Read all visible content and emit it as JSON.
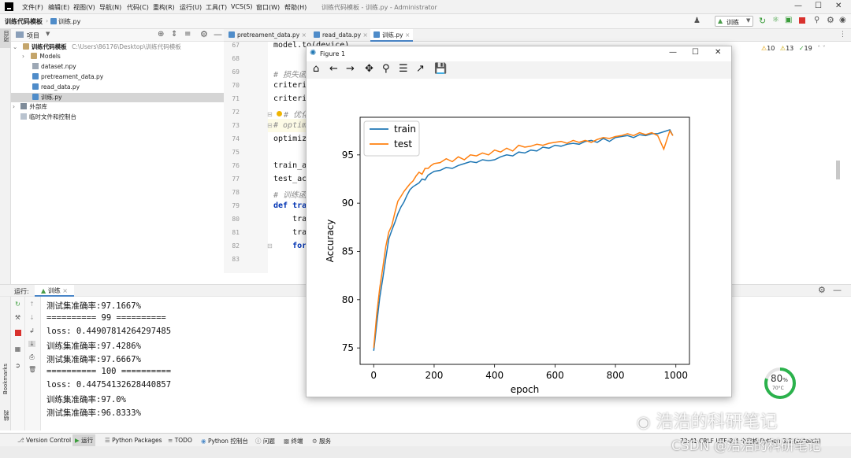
{
  "titlebar": {
    "menus": [
      "文件(F)",
      "编辑(E)",
      "视图(V)",
      "导航(N)",
      "代码(C)",
      "重构(R)",
      "运行(U)",
      "工具(T)",
      "VCS(S)",
      "窗口(W)",
      "帮助(H)"
    ],
    "window_title": "训练代码模板 - 训练.py - Administrator"
  },
  "navbar": {
    "project": "训练代码模板",
    "file": "训练.py",
    "run_config": "训练"
  },
  "project_panel": {
    "header": "项目",
    "root": "训练代码模板",
    "root_path": "C:\\Users\\86176\\Desktop\\训练代码模板",
    "items": [
      "Models",
      "dataset.npy",
      "pretreament_data.py",
      "read_data.py",
      "训练.py"
    ],
    "external": "外部库",
    "scratches": "临时文件和控制台"
  },
  "left_strip": {
    "project": "项目",
    "bookmarks": "Bookmarks",
    "structure": "结构"
  },
  "editor": {
    "tabs": [
      "pretreament_data.py",
      "read_data.py",
      "训练.py"
    ],
    "line_numbers": [
      "67",
      "68",
      "69",
      "70",
      "71",
      "72",
      "73",
      "74",
      "75",
      "76",
      "77",
      "78",
      "79",
      "80",
      "81",
      "82",
      "83"
    ],
    "lines": [
      "model.to(device)",
      "",
      "# 损失函",
      "criteri",
      "criteri",
      "# 优化器",
      "# optim",
      "optimiz",
      "",
      "train_a",
      "test_ac",
      "# 训练函",
      "def tra",
      "    tra",
      "    tra",
      "    for",
      ""
    ],
    "inspection": {
      "warnings": "10",
      "weak": "13",
      "typos": "19"
    }
  },
  "run_panel": {
    "label": "运行:",
    "config": "训练"
  },
  "console_lines": [
    "测试集准确率:97.1667%",
    "========== 99 ==========",
    "loss: 0.44907814264297485",
    "训练集准确率:97.4286%",
    "测试集准确率:97.6667%",
    "========== 100 ==========",
    "loss: 0.44754132628440857",
    "训练集准确率:97.0%",
    "测试集准确率:96.8333%"
  ],
  "statusbar": {
    "items": [
      "Version Control",
      "运行",
      "Python Packages",
      "TODO",
      "Python 控制台",
      "问题",
      "终端",
      "服务"
    ],
    "right": "73:41   CRLF   UTF-8   4 个空格   Python 3.8 (pytorch)"
  },
  "figure": {
    "title": "Figure 1"
  },
  "gauge": {
    "percent": "80",
    "percent_sign": "%",
    "temp": "70°C",
    "fraction": 0.8
  },
  "watermark": {
    "wechat": "浩浩的科研笔记",
    "csdn": "CSDN @浩浩的科研笔记"
  },
  "colors": {
    "train": "#1f77b4",
    "test": "#ff7f0e",
    "gauge": "#2bb24c"
  },
  "chart_data": {
    "type": "line",
    "title": "",
    "xlabel": "epoch",
    "ylabel": "Accuracy",
    "xlim": [
      -45,
      1045
    ],
    "ylim": [
      73.3,
      98.9
    ],
    "xticks": [
      0,
      200,
      400,
      600,
      800,
      1000
    ],
    "yticks": [
      75,
      80,
      85,
      90,
      95
    ],
    "legend": "top-left",
    "grid": false,
    "series": [
      {
        "name": "train",
        "x": [
          0,
          10,
          20,
          30,
          40,
          50,
          60,
          70,
          80,
          90,
          100,
          110,
          120,
          130,
          140,
          150,
          160,
          170,
          180,
          190,
          200,
          220,
          240,
          260,
          280,
          300,
          320,
          340,
          360,
          380,
          400,
          420,
          440,
          460,
          480,
          500,
          520,
          540,
          560,
          580,
          600,
          620,
          640,
          660,
          680,
          700,
          720,
          740,
          760,
          780,
          800,
          820,
          840,
          860,
          880,
          900,
          920,
          940,
          960,
          980,
          990
        ],
        "y": [
          74.7,
          77.5,
          80.2,
          82.2,
          84.3,
          86.3,
          87.2,
          88.0,
          88.9,
          89.6,
          90.1,
          90.8,
          91.4,
          91.7,
          91.9,
          92.1,
          92.5,
          92.4,
          92.9,
          93.1,
          93.3,
          93.4,
          93.7,
          93.6,
          93.9,
          94.1,
          94.3,
          94.2,
          94.5,
          94.4,
          94.5,
          94.8,
          95.0,
          94.9,
          95.3,
          95.2,
          95.5,
          95.4,
          95.8,
          95.7,
          96.0,
          95.9,
          96.1,
          96.2,
          96.1,
          96.4,
          96.5,
          96.3,
          96.7,
          96.4,
          96.8,
          96.9,
          97.0,
          96.8,
          97.1,
          97.0,
          97.2,
          97.2,
          97.4,
          97.6,
          97.0
        ]
      },
      {
        "name": "test",
        "x": [
          0,
          10,
          20,
          30,
          40,
          50,
          60,
          70,
          80,
          90,
          100,
          110,
          120,
          130,
          140,
          150,
          160,
          170,
          180,
          190,
          200,
          220,
          240,
          260,
          280,
          300,
          320,
          340,
          360,
          380,
          400,
          420,
          440,
          460,
          480,
          500,
          520,
          540,
          560,
          580,
          600,
          620,
          640,
          660,
          680,
          700,
          720,
          740,
          760,
          780,
          800,
          820,
          840,
          860,
          880,
          900,
          920,
          940,
          960,
          980,
          990
        ],
        "y": [
          75.0,
          78.5,
          81.2,
          83.3,
          85.5,
          87.0,
          87.7,
          89.0,
          90.2,
          90.7,
          91.2,
          91.6,
          92.0,
          92.3,
          92.8,
          93.2,
          93.0,
          93.6,
          93.6,
          93.9,
          94.1,
          94.2,
          94.6,
          94.3,
          94.8,
          94.5,
          95.0,
          94.9,
          95.2,
          95.0,
          95.5,
          95.3,
          95.7,
          95.4,
          96.0,
          95.8,
          95.9,
          96.1,
          96.0,
          96.2,
          96.3,
          96.4,
          96.2,
          96.5,
          96.3,
          96.5,
          96.3,
          96.6,
          96.8,
          96.7,
          96.9,
          97.0,
          97.2,
          97.0,
          97.3,
          97.1,
          97.3,
          97.0,
          95.6,
          97.5,
          97.0
        ]
      }
    ]
  }
}
